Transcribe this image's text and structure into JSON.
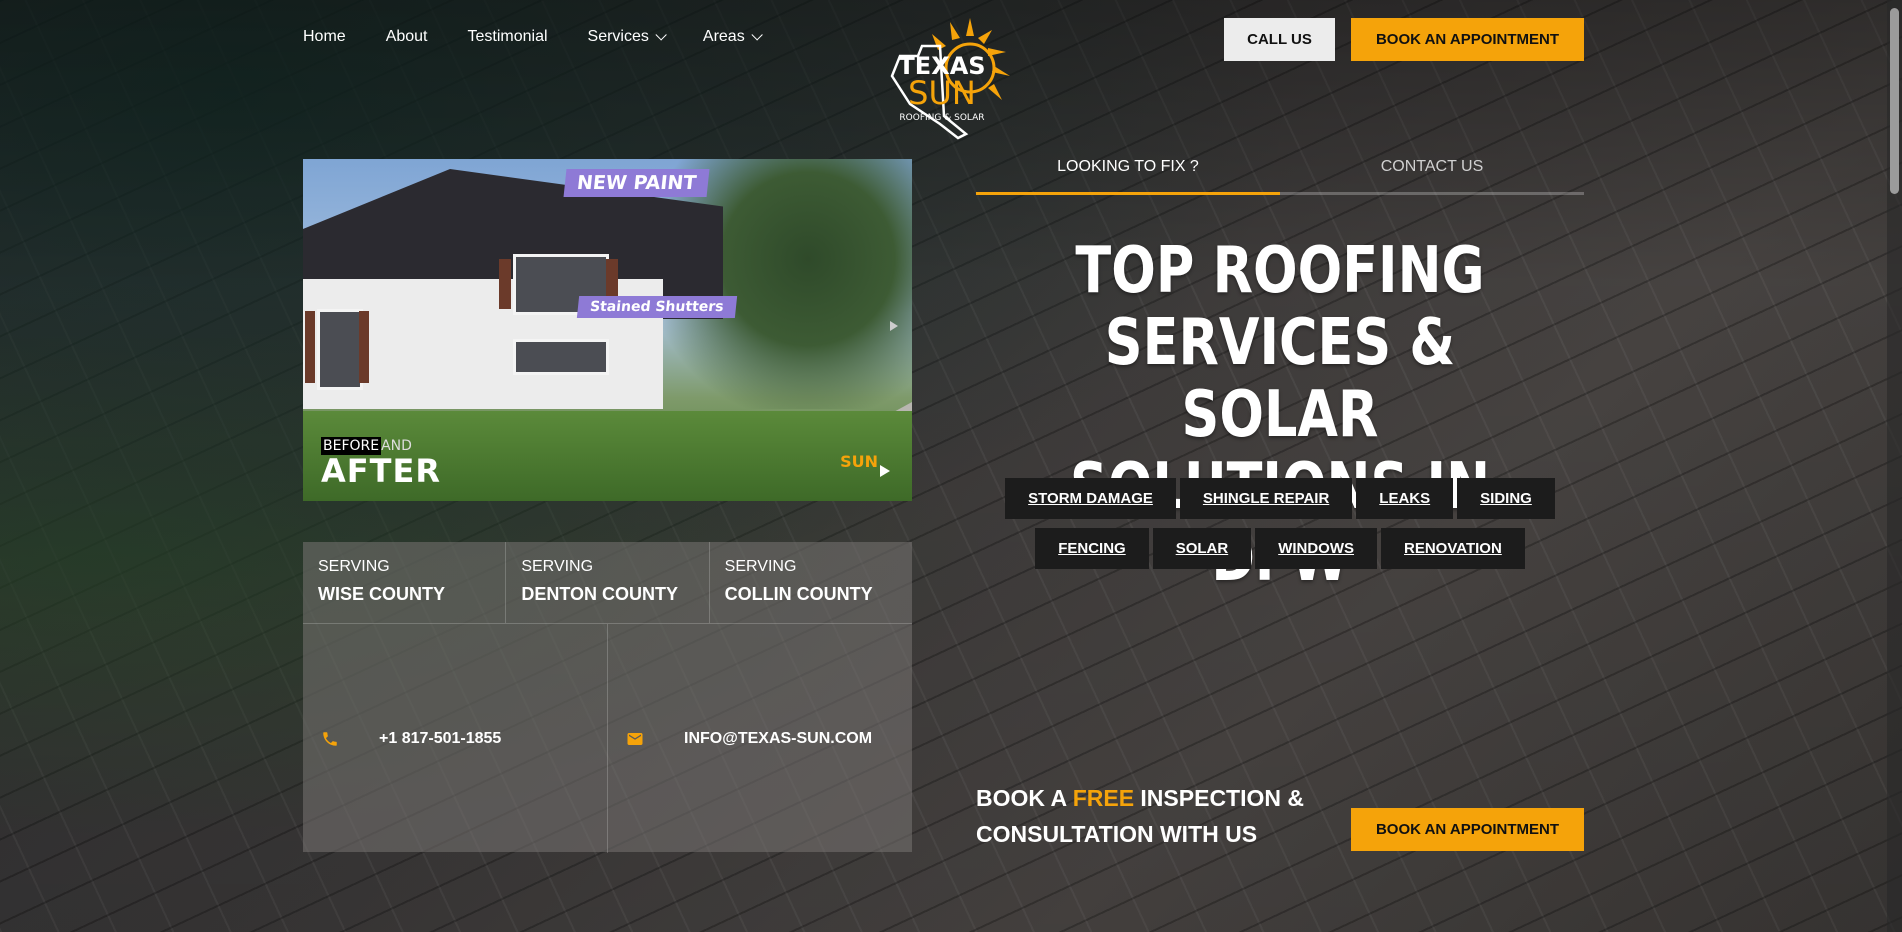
{
  "nav": {
    "items": [
      {
        "label": "Home"
      },
      {
        "label": "About"
      },
      {
        "label": "Testimonial"
      },
      {
        "label": "Services"
      },
      {
        "label": "Areas"
      }
    ]
  },
  "logo": {
    "line1": "TEXAS",
    "line2": "SUN",
    "line3": "ROOFING & SOLAR"
  },
  "header": {
    "call_label": "CALL US",
    "book_label": "BOOK AN APPOINTMENT"
  },
  "video": {
    "tag_paint": "NEW PAINT",
    "tag_shutters": "Stained Shutters",
    "before": "BEFORE",
    "and": "AND",
    "after": "AFTER",
    "watermark": "SUN"
  },
  "counties": [
    {
      "label": "SERVING",
      "name": "WISE COUNTY"
    },
    {
      "label": "SERVING",
      "name": "DENTON COUNTY"
    },
    {
      "label": "SERVING",
      "name": "COLLIN COUNTY"
    }
  ],
  "contacts": {
    "phone": "+1 817-501-1855",
    "email": "INFO@TEXAS-SUN.COM"
  },
  "tabs": {
    "fix": "LOOKING TO FIX ?",
    "contact": "CONTACT US"
  },
  "headline": "TOP ROOFING SERVICES & SOLAR SOLUTIONS IN DFW",
  "services": [
    "STORM DAMAGE",
    "SHINGLE REPAIR",
    "LEAKS",
    "SIDING",
    "FENCING",
    "SOLAR",
    "WINDOWS",
    "RENOVATION"
  ],
  "cta": {
    "part1": "BOOK A ",
    "highlight": "FREE",
    "part2": " INSPECTION & CONSULTATION WITH US",
    "button": "BOOK AN APPOINTMENT"
  },
  "colors": {
    "accent": "#f5a30a",
    "chip_bg": "#1c1c1c"
  }
}
